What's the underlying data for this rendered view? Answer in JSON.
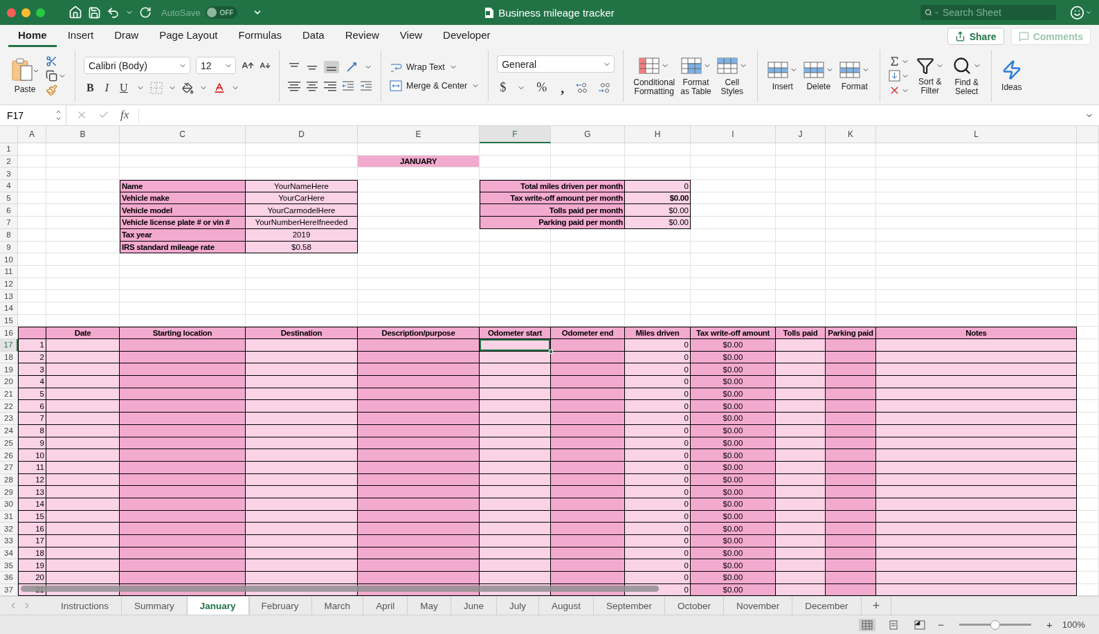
{
  "title_bar": {
    "autosave_label": "AutoSave",
    "autosave_state": "OFF",
    "autosave_on": false,
    "title": "Business mileage tracker",
    "search_placeholder": "Search Sheet"
  },
  "ribbon_tabs": [
    {
      "label": "Home",
      "selected": true
    },
    {
      "label": "Insert",
      "selected": false
    },
    {
      "label": "Draw",
      "selected": false
    },
    {
      "label": "Page Layout",
      "selected": false
    },
    {
      "label": "Formulas",
      "selected": false
    },
    {
      "label": "Data",
      "selected": false
    },
    {
      "label": "Review",
      "selected": false
    },
    {
      "label": "View",
      "selected": false
    },
    {
      "label": "Developer",
      "selected": false
    }
  ],
  "share": "Share",
  "comments": "Comments",
  "ribbon": {
    "paste": "Paste",
    "font_name": "Calibri (Body)",
    "font_size": "12",
    "bold": "B",
    "italic": "I",
    "underline": "U",
    "wrap_text": "Wrap Text",
    "merge_center": "Merge & Center",
    "number_format": "General",
    "currency": "$",
    "percent": "%",
    "comma": ",",
    "styles": [
      "Conditional\nFormatting",
      "Format\nas Table",
      "Cell\nStyles"
    ],
    "cells": [
      "Insert",
      "Delete",
      "Format"
    ],
    "sort_filter": "Sort &\nFilter",
    "find_select": "Find &\nSelect",
    "ideas": "Ideas"
  },
  "formula_bar": {
    "name_box": "F17",
    "fx": "fx"
  },
  "columns": [
    {
      "label": "A",
      "selected": false
    },
    {
      "label": "B",
      "selected": false
    },
    {
      "label": "C",
      "selected": false
    },
    {
      "label": "D",
      "selected": false
    },
    {
      "label": "E",
      "selected": false
    },
    {
      "label": "F",
      "selected": true
    },
    {
      "label": "G",
      "selected": false
    },
    {
      "label": "H",
      "selected": false
    },
    {
      "label": "I",
      "selected": false
    },
    {
      "label": "J",
      "selected": false
    },
    {
      "label": "K",
      "selected": false
    },
    {
      "label": "L",
      "selected": false
    }
  ],
  "row_headers": [
    {
      "label": "1",
      "selected": false
    },
    {
      "label": "2",
      "selected": false
    },
    {
      "label": "3",
      "selected": false
    },
    {
      "label": "4",
      "selected": false
    },
    {
      "label": "5",
      "selected": false
    },
    {
      "label": "6",
      "selected": false
    },
    {
      "label": "7",
      "selected": false
    },
    {
      "label": "8",
      "selected": false
    },
    {
      "label": "9",
      "selected": false
    },
    {
      "label": "10",
      "selected": false
    },
    {
      "label": "11",
      "selected": false
    },
    {
      "label": "12",
      "selected": false
    },
    {
      "label": "13",
      "selected": false
    },
    {
      "label": "14",
      "selected": false
    },
    {
      "label": "15",
      "selected": false
    },
    {
      "label": "16",
      "selected": false
    },
    {
      "label": "17",
      "selected": true
    },
    {
      "label": "18",
      "selected": false
    },
    {
      "label": "19",
      "selected": false
    },
    {
      "label": "20",
      "selected": false
    },
    {
      "label": "21",
      "selected": false
    },
    {
      "label": "22",
      "selected": false
    },
    {
      "label": "23",
      "selected": false
    },
    {
      "label": "24",
      "selected": false
    },
    {
      "label": "25",
      "selected": false
    },
    {
      "label": "26",
      "selected": false
    },
    {
      "label": "27",
      "selected": false
    },
    {
      "label": "28",
      "selected": false
    },
    {
      "label": "29",
      "selected": false
    },
    {
      "label": "30",
      "selected": false
    },
    {
      "label": "31",
      "selected": false
    },
    {
      "label": "32",
      "selected": false
    },
    {
      "label": "33",
      "selected": false
    },
    {
      "label": "34",
      "selected": false
    },
    {
      "label": "35",
      "selected": false
    },
    {
      "label": "36",
      "selected": false
    },
    {
      "label": "37",
      "selected": false
    }
  ],
  "sheet": {
    "month": "JANUARY",
    "info": [
      {
        "label": "Name",
        "value": "YourNameHere"
      },
      {
        "label": "Vehicle make",
        "value": "YourCarHere"
      },
      {
        "label": "Vehicle model",
        "value": "YourCarmodelHere"
      },
      {
        "label": "Vehicle license plate # or vin #",
        "value": "YourNumberHereIfneeded"
      },
      {
        "label": "Tax year",
        "value": "2019"
      },
      {
        "label": "IRS standard mileage rate",
        "value": "$0.58"
      }
    ],
    "summary": [
      {
        "label": "Total miles driven per month",
        "value": "0",
        "bold": false
      },
      {
        "label": "Tax write-off amount per month",
        "value": "$0.00",
        "bold": true
      },
      {
        "label": "Tolls paid per month",
        "value": "$0.00",
        "bold": false
      },
      {
        "label": "Parking paid per month",
        "value": "$0.00",
        "bold": false
      }
    ],
    "log_headers": [
      "Date",
      "Starting location",
      "Destination",
      "Description/purpose",
      "Odometer start",
      "Odometer end",
      "Miles driven",
      "Tax write-off amount",
      "Tolls paid",
      "Parking paid",
      "Notes"
    ],
    "log_rows": [
      {
        "num": "1",
        "miles": "0",
        "tax": "$0.00",
        "selected": true
      },
      {
        "num": "2",
        "miles": "0",
        "tax": "$0.00",
        "selected": false
      },
      {
        "num": "3",
        "miles": "0",
        "tax": "$0.00",
        "selected": false
      },
      {
        "num": "4",
        "miles": "0",
        "tax": "$0.00",
        "selected": false
      },
      {
        "num": "5",
        "miles": "0",
        "tax": "$0.00",
        "selected": false
      },
      {
        "num": "6",
        "miles": "0",
        "tax": "$0.00",
        "selected": false
      },
      {
        "num": "7",
        "miles": "0",
        "tax": "$0.00",
        "selected": false
      },
      {
        "num": "8",
        "miles": "0",
        "tax": "$0.00",
        "selected": false
      },
      {
        "num": "9",
        "miles": "0",
        "tax": "$0.00",
        "selected": false
      },
      {
        "num": "10",
        "miles": "0",
        "tax": "$0.00",
        "selected": false
      },
      {
        "num": "11",
        "miles": "0",
        "tax": "$0.00",
        "selected": false
      },
      {
        "num": "12",
        "miles": "0",
        "tax": "$0.00",
        "selected": false
      },
      {
        "num": "13",
        "miles": "0",
        "tax": "$0.00",
        "selected": false
      },
      {
        "num": "14",
        "miles": "0",
        "tax": "$0.00",
        "selected": false
      },
      {
        "num": "15",
        "miles": "0",
        "tax": "$0.00",
        "selected": false
      },
      {
        "num": "16",
        "miles": "0",
        "tax": "$0.00",
        "selected": false
      },
      {
        "num": "17",
        "miles": "0",
        "tax": "$0.00",
        "selected": false
      },
      {
        "num": "18",
        "miles": "0",
        "tax": "$0.00",
        "selected": false
      },
      {
        "num": "19",
        "miles": "0",
        "tax": "$0.00",
        "selected": false
      },
      {
        "num": "20",
        "miles": "0",
        "tax": "$0.00",
        "selected": false
      },
      {
        "num": "21",
        "miles": "0",
        "tax": "$0.00",
        "selected": false
      }
    ]
  },
  "sheet_tabs": [
    {
      "label": "Instructions",
      "selected": false
    },
    {
      "label": "Summary",
      "selected": false
    },
    {
      "label": "January",
      "selected": true
    },
    {
      "label": "February",
      "selected": false
    },
    {
      "label": "March",
      "selected": false
    },
    {
      "label": "April",
      "selected": false
    },
    {
      "label": "May",
      "selected": false
    },
    {
      "label": "June",
      "selected": false
    },
    {
      "label": "July",
      "selected": false
    },
    {
      "label": "August",
      "selected": false
    },
    {
      "label": "September",
      "selected": false
    },
    {
      "label": "October",
      "selected": false
    },
    {
      "label": "November",
      "selected": false
    },
    {
      "label": "December",
      "selected": false
    }
  ],
  "add_sheet": "+",
  "status_bar": {
    "zoom_out": "−",
    "zoom_in": "+",
    "zoom": "100%",
    "level": 0.5
  }
}
